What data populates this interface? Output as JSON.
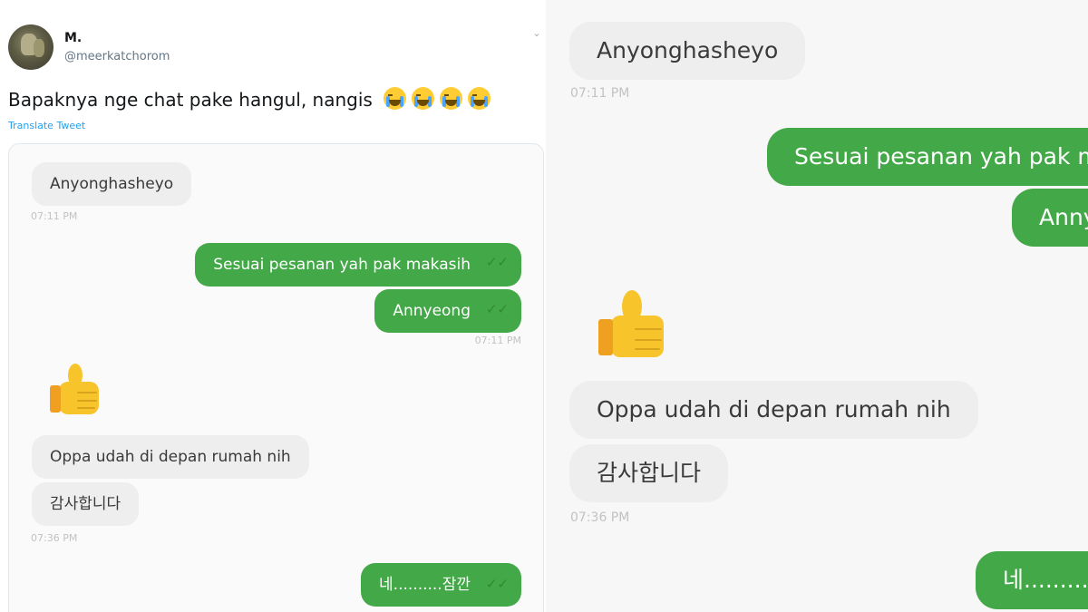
{
  "tweet": {
    "display_name": "M.",
    "handle": "@meerkatchorom",
    "text": "Bapaknya nge chat pake hangul, nangis",
    "emoji_icon": "loudly-crying-face-icon",
    "emoji_count": 4,
    "translate_label": "Translate Tweet"
  },
  "chat": {
    "messages": [
      {
        "dir": "in",
        "text": "Anyonghasheyo"
      },
      {
        "time": "07:11 PM"
      },
      {
        "dir": "out",
        "text": "Sesuai pesanan yah pak makasih"
      },
      {
        "dir": "out",
        "text": "Annyeong"
      },
      {
        "time": "07:11 PM"
      },
      {
        "dir": "in",
        "emoji": "thumbs-up-icon"
      },
      {
        "dir": "in",
        "text": "Oppa udah di depan rumah nih"
      },
      {
        "dir": "in",
        "text": "감사합니다"
      },
      {
        "time": "07:36 PM"
      },
      {
        "dir": "out",
        "text": "네..........잠깐"
      }
    ]
  },
  "colors": {
    "outgoing_bubble": "#43a847",
    "incoming_bubble": "#eeeeee",
    "link": "#1da1f2",
    "timestamp": "#c2c2c2"
  }
}
